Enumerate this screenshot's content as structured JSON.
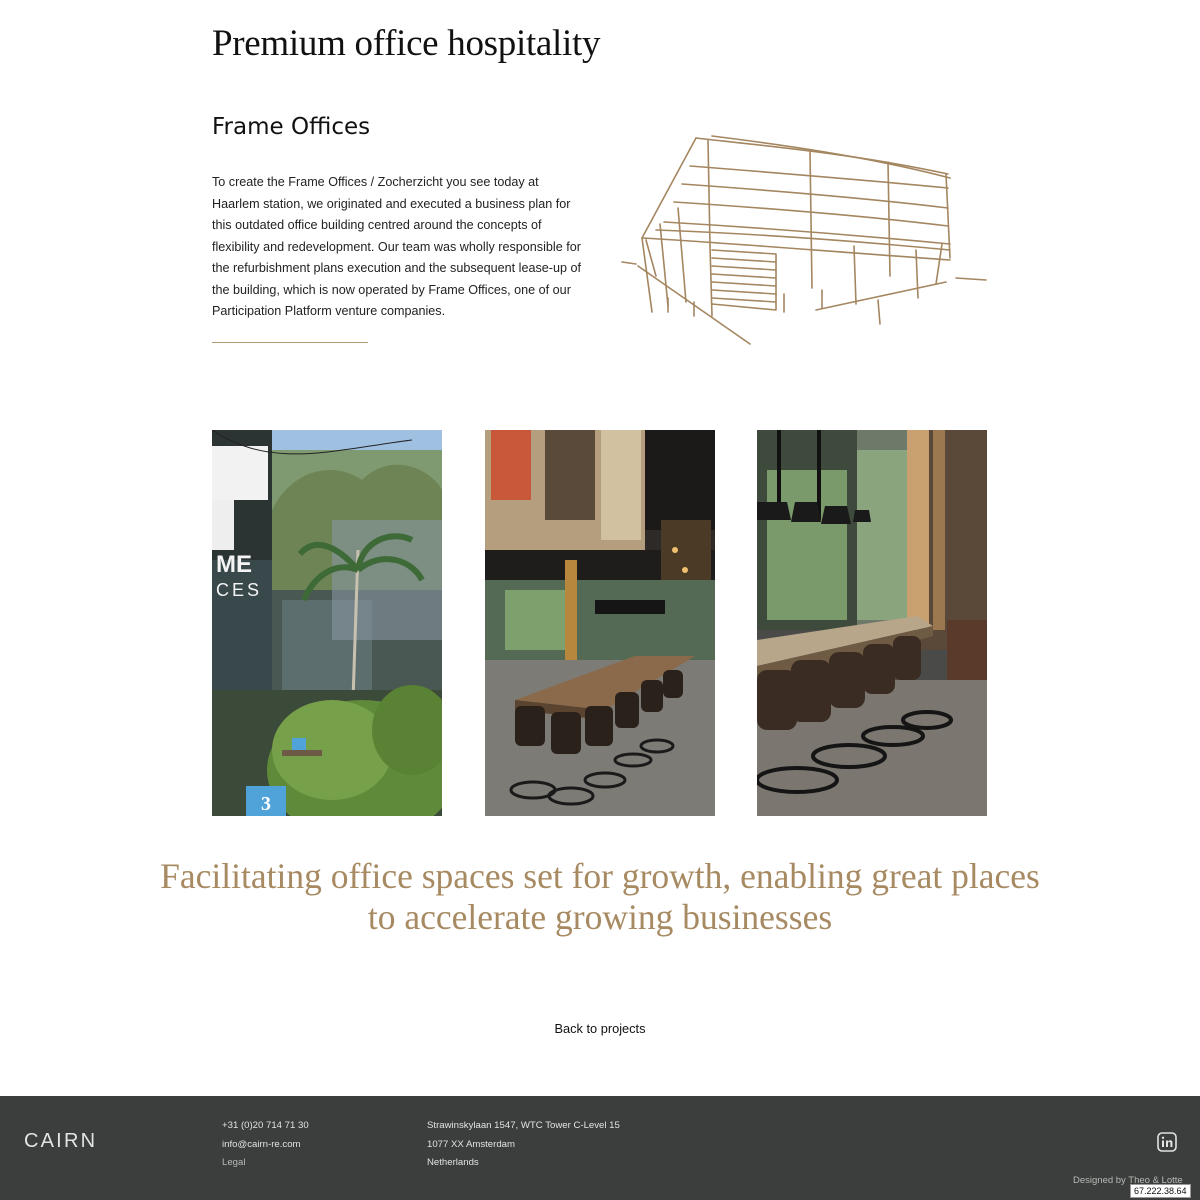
{
  "page": {
    "title": "Premium office hospitality"
  },
  "project": {
    "name": "Frame Offices",
    "description": "To create the Frame Offices / Zocherzicht you see today at Haarlem station, we originated and executed a business plan for this outdated office building centred around the concepts of flexibility and redevelopment. Our team was wholly responsible for the refurbishment plans execution and the subsequent lease-up of the building, which is now operated by Frame Offices, one of our Participation Platform venture companies."
  },
  "gallery": {
    "photo1_sign_line1": "ME",
    "photo1_sign_line2": "CES",
    "photo1_cube_number": "3"
  },
  "tagline": "Facilitating office spaces set for growth, enabling great places to accelerate growing businesses",
  "navigation": {
    "back_label": "Back to projects"
  },
  "footer": {
    "logo": "CAIRN",
    "phone": "+31 (0)20 714 71 30",
    "email": "info@cairn-re.com",
    "legal": "Legal",
    "address_line1": "Strawinskylaan 1547, WTC Tower C-Level 15",
    "address_line2": "1077 XX Amsterdam",
    "address_line3": "Netherlands",
    "credit": "Designed by Theo & Lotte",
    "linkedin_icon": "linkedin-icon"
  },
  "overlay": {
    "ip": "67.222.38.64"
  },
  "colors": {
    "accent": "#a78a62",
    "footer_bg": "#3b3e3c",
    "footer_text": "#e3e3e1"
  }
}
